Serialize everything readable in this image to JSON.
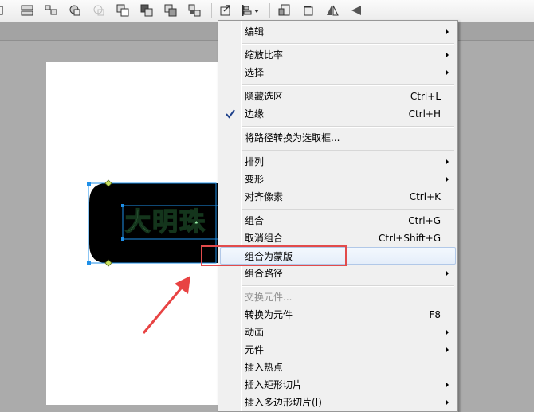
{
  "toolbar": {
    "icons": [
      "distribute-icon",
      "align-icon",
      "union-icon",
      "intersect-icon",
      "punch-icon",
      "crop-icon",
      "group-icon",
      "ungroup-icon",
      "convert-icon",
      "align-dropdown-icon",
      "bring-front-icon",
      "send-back-icon",
      "flip-horizontal-icon",
      "flip-vertical-icon"
    ]
  },
  "canvas": {
    "banner_text": "大明珠"
  },
  "context_menu": {
    "items": [
      {
        "label": "编辑",
        "shortcut": "",
        "submenu": true
      },
      {
        "label": "缩放比率",
        "shortcut": "",
        "submenu": true
      },
      {
        "label": "选择",
        "shortcut": "",
        "submenu": true
      },
      {
        "label": "隐藏选区",
        "shortcut": "Ctrl+L",
        "submenu": false
      },
      {
        "label": "边缘",
        "shortcut": "Ctrl+H",
        "submenu": false,
        "checked": true
      },
      {
        "label": "将路径转换为选取框...",
        "shortcut": "",
        "submenu": false
      },
      {
        "label": "排列",
        "shortcut": "",
        "submenu": true
      },
      {
        "label": "变形",
        "shortcut": "",
        "submenu": true
      },
      {
        "label": "对齐像素",
        "shortcut": "Ctrl+K",
        "submenu": false
      },
      {
        "label": "组合",
        "shortcut": "Ctrl+G",
        "submenu": false
      },
      {
        "label": "取消组合",
        "shortcut": "Ctrl+Shift+G",
        "submenu": false
      },
      {
        "label": "组合为蒙版",
        "shortcut": "",
        "submenu": false,
        "highlighted": true
      },
      {
        "label": "组合路径",
        "shortcut": "",
        "submenu": true
      },
      {
        "label": "交换元件...",
        "shortcut": "",
        "submenu": false,
        "disabled": true
      },
      {
        "label": "转换为元件",
        "shortcut": "F8",
        "submenu": false
      },
      {
        "label": "动画",
        "shortcut": "",
        "submenu": true
      },
      {
        "label": "元件",
        "shortcut": "",
        "submenu": true
      },
      {
        "label": "插入热点",
        "shortcut": "",
        "submenu": false
      },
      {
        "label": "插入矩形切片",
        "shortcut": "",
        "submenu": true
      },
      {
        "label": "插入多边形切片(I)",
        "shortcut": "",
        "submenu": true
      }
    ]
  },
  "colors": {
    "menu_bg": "#f0f0f0",
    "highlight_border": "#b1c8e8",
    "annotation_red": "#e24b4b",
    "banner_text": "#96f0a8",
    "selection_handle": "#1e8fe8"
  }
}
